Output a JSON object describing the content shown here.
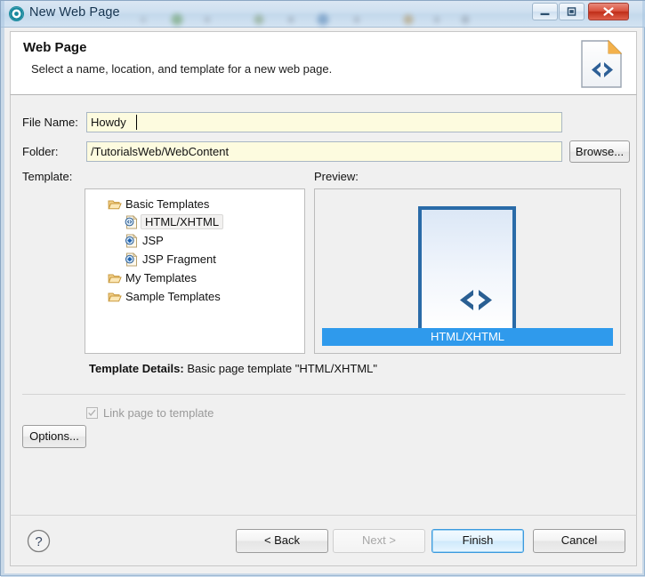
{
  "window": {
    "title": "New Web Page",
    "title_icon": "eclipse-circle-icon",
    "controls": {
      "minimize": "minimize-icon",
      "maximize": "maximize-icon",
      "close": "close-icon"
    }
  },
  "header": {
    "title": "Web Page",
    "subtitle": "Select a name, location, and template for a new web page.",
    "icon": "web-page-document-icon"
  },
  "form": {
    "file_name_label": "File Name:",
    "file_name_value": "Howdy",
    "file_name_placeholder": "",
    "folder_label": "Folder:",
    "folder_value": "/TutorialsWeb/WebContent",
    "folder_placeholder": "",
    "browse_label": "Browse...",
    "template_label": "Template:",
    "preview_label": "Preview:"
  },
  "tree": {
    "items": [
      {
        "label": "Basic Templates",
        "icon": "folder-open-icon",
        "indent": 0,
        "selected": false
      },
      {
        "label": "HTML/XHTML",
        "icon": "html-file-icon",
        "indent": 1,
        "selected": true
      },
      {
        "label": "JSP",
        "icon": "jsp-file-icon",
        "indent": 1,
        "selected": false
      },
      {
        "label": "JSP Fragment",
        "icon": "jsp-file-icon",
        "indent": 1,
        "selected": false
      },
      {
        "label": "My Templates",
        "icon": "folder-open-icon",
        "indent": 0,
        "selected": false
      },
      {
        "label": "Sample Templates",
        "icon": "folder-open-icon",
        "indent": 0,
        "selected": false
      }
    ]
  },
  "preview": {
    "caption": "HTML/XHTML",
    "page_icon": "html-page-preview-icon"
  },
  "details": {
    "label": "Template Details:",
    "value": "Basic page template \"HTML/XHTML\"",
    "link_checkbox_label": "Link page to template",
    "link_checkbox_checked": true,
    "link_checkbox_disabled": true
  },
  "buttons": {
    "options": "Options...",
    "help": "?",
    "back": "< Back",
    "next": "Next >",
    "finish": "Finish",
    "cancel": "Cancel"
  },
  "colors": {
    "accent_blue": "#2f9aec",
    "field_yellow": "#fdfbdf",
    "default_button_border": "#3c9ade",
    "close_button_red": "#bf2d18"
  }
}
